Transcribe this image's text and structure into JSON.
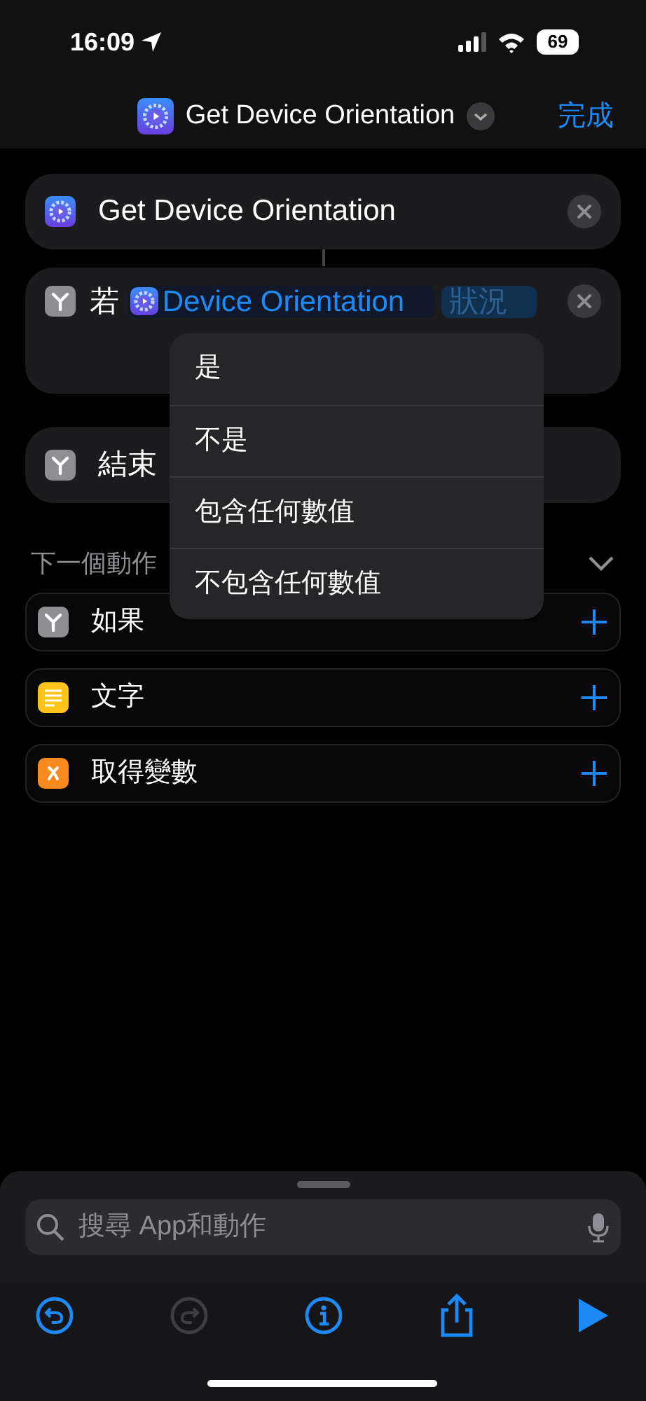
{
  "status_bar": {
    "time": "16:09",
    "battery": "69"
  },
  "nav": {
    "title": "Get Device Orientation",
    "done": "完成"
  },
  "actions": [
    {
      "kind": "app",
      "title": "Get Device Orientation"
    },
    {
      "kind": "if",
      "word": "若",
      "variable": "Device Orientation",
      "condition": "狀況"
    },
    {
      "kind": "endif",
      "title": "結束"
    }
  ],
  "menu": {
    "items": [
      "是",
      "不是",
      "包含任何數值",
      "不包含任何數值"
    ]
  },
  "next": {
    "heading": "下一個動作",
    "expanded": true
  },
  "suggestions": [
    {
      "kind": "branch",
      "label": "如果",
      "color": "#8e8e93"
    },
    {
      "kind": "text",
      "label": "文字",
      "color": "#fcc41b"
    },
    {
      "kind": "variable",
      "label": "取得變數",
      "color": "#f98a1e"
    }
  ],
  "search": {
    "placeholder": "搜尋 App和動作"
  },
  "toolbar": [
    {
      "kind": "undo",
      "disabled": false
    },
    {
      "kind": "redo",
      "disabled": true
    },
    {
      "kind": "info",
      "disabled": false
    },
    {
      "kind": "share",
      "disabled": false
    },
    {
      "kind": "run",
      "disabled": false
    }
  ]
}
